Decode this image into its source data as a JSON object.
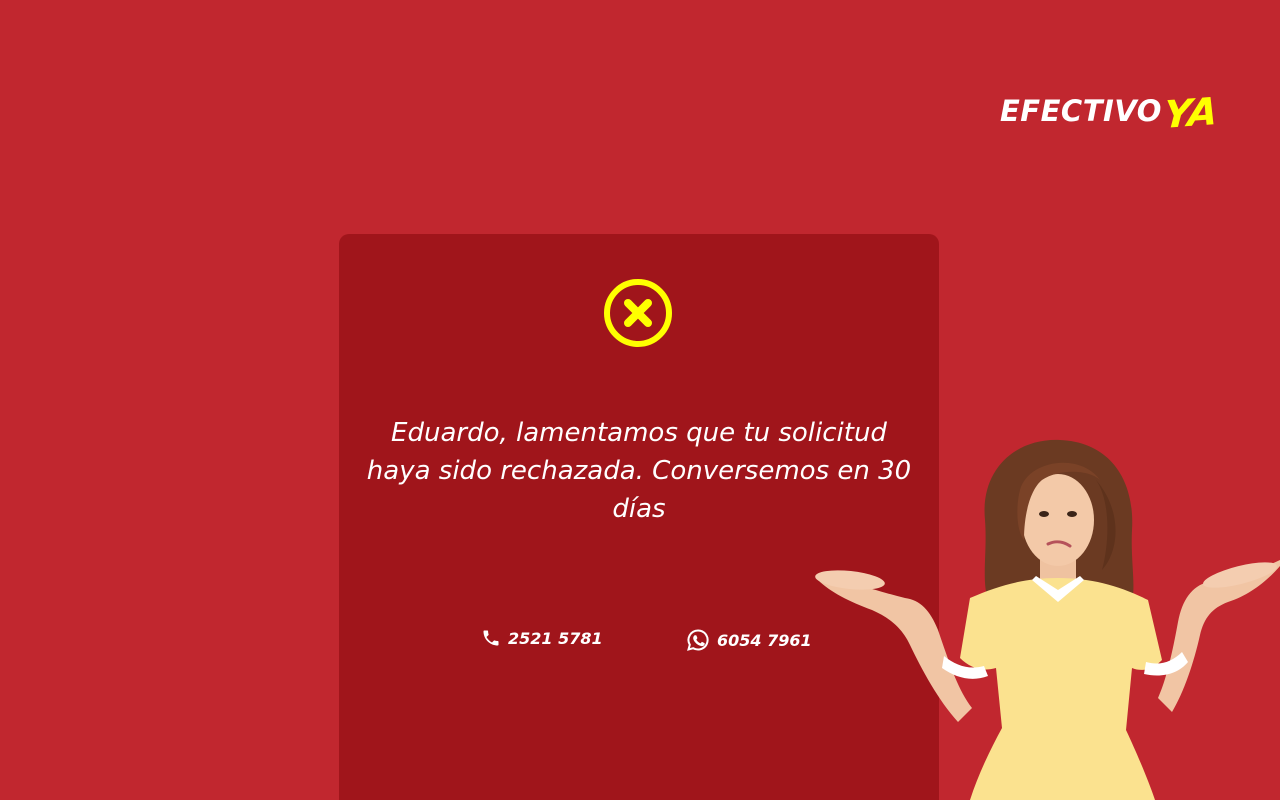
{
  "brand": {
    "logo_main": "EFECTIVO",
    "logo_accent": "YA",
    "accent_color": "#ffff00",
    "background_color": "#c1272f",
    "card_color": "#a0151b"
  },
  "status": {
    "icon": "close-circle-icon",
    "message": "Eduardo, lamentamos que tu solicitud haya sido rechazada. Conversemos en 30 días"
  },
  "contacts": {
    "phone": {
      "icon": "phone-icon",
      "number": "2521 5781"
    },
    "whatsapp": {
      "icon": "whatsapp-icon",
      "number": "6054 7961"
    }
  }
}
